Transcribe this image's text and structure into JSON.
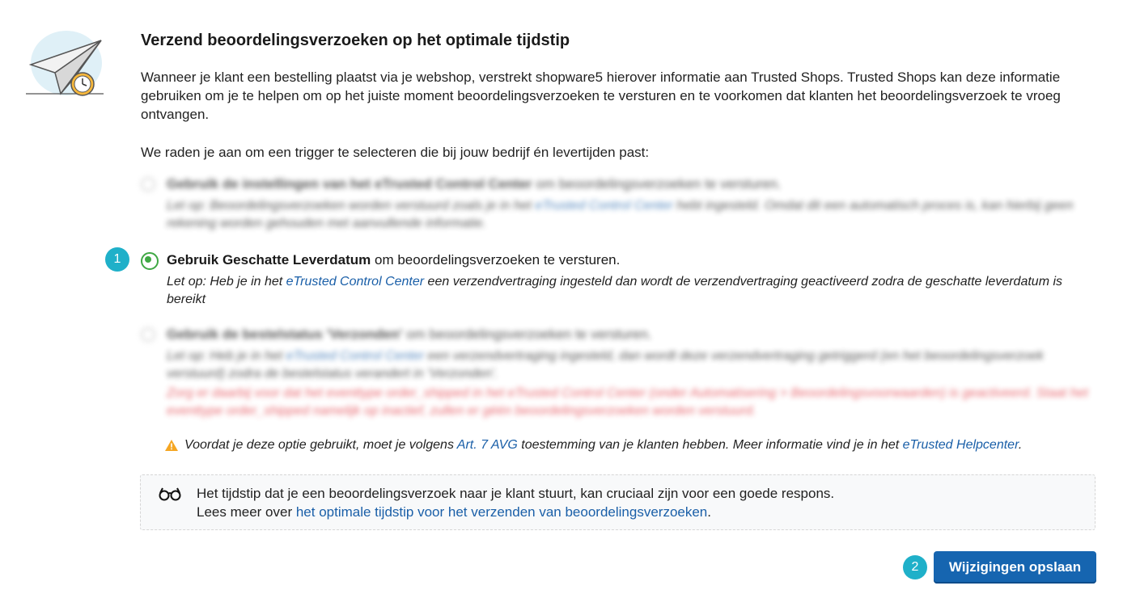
{
  "header": {
    "title": "Verzend beoordelingsverzoeken op het optimale tijdstip"
  },
  "intro": "Wanneer je klant een bestelling plaatst via je webshop, verstrekt shopware5 hierover informatie aan Trusted Shops. Trusted Shops kan deze informatie gebruiken om je te helpen om op het juiste moment beoordelingsverzoeken te versturen en te voorkomen dat klanten het beoordelingsverzoek te vroeg ontvangen.",
  "recommend": "We raden je aan om een trigger te selecteren die bij jouw bedrijf én levertijden past:",
  "options": [
    {
      "title_bold": "Gebruik de instellingen van het eTrusted Control Center",
      "title_rest": " om beoordelingsverzoeken te versturen.",
      "note_pre": "Let op: Beoordelingsverzoeken worden verstuurd zoals je in het ",
      "note_link": "eTrusted Control Center",
      "note_post": " hebt ingesteld. Omdat dit een automatisch proces is, kan hierbij geen rekening worden gehouden met aanvullende informatie.",
      "selected": false,
      "blurred": true
    },
    {
      "title_bold": "Gebruik Geschatte Leverdatum",
      "title_rest": " om beoordelingsverzoeken te versturen.",
      "note_pre": "Let op: Heb je in het ",
      "note_link": "eTrusted Control Center",
      "note_post": " een verzendvertraging ingesteld dan wordt de verzendvertraging geactiveerd zodra de geschatte leverdatum is bereikt",
      "selected": true,
      "blurred": false
    },
    {
      "title_bold": "Gebruik de bestelstatus 'Verzonden'",
      "title_rest": " om beoordelingsverzoeken te versturen.",
      "note_pre": "Let op: Heb je in het ",
      "note_link": "eTrusted Control Center",
      "note_post": " een verzendvertraging ingesteld, dan wordt deze verzendvertraging getriggerd (en het beoordelingsverzoek verstuurd) zodra de bestelstatus verandert in 'Verzonden'.",
      "note_red": "Zorg er daarbij voor dat het eventtype order_shipped in het eTrusted Control Center (onder Automatisering > Beoordelingsvoorwaarden) is geactiveerd. Staat het eventtype order_shipped namelijk op inactief, zullen er géén beoordelingsverzoeken worden verstuurd.",
      "selected": false,
      "blurred": true
    }
  ],
  "badges": {
    "step1": "1",
    "step2": "2"
  },
  "warning": {
    "pre": "Voordat je deze optie gebruikt, moet je volgens ",
    "link1": "Art. 7 AVG",
    "mid": " toestemming van je klanten hebben. Meer informatie vind je in het ",
    "link2": "eTrusted Helpcenter",
    "post": "."
  },
  "tip": {
    "line1": "Het tijdstip dat je een beoordelingsverzoek naar je klant stuurt, kan cruciaal zijn voor een goede respons.",
    "line2_pre": "Lees meer over ",
    "line2_link": "het optimale tijdstip voor het verzenden van beoordelingsverzoeken",
    "line2_post": "."
  },
  "actions": {
    "save_label": "Wijzigingen opslaan"
  },
  "colors": {
    "accent": "#1665b0",
    "link": "#1a5fa8",
    "selected_radio": "#3fa844",
    "step_badge": "#1fb0c9",
    "warning": "#f5a623",
    "error": "#e0353f"
  },
  "icons": {
    "logo": "paper-plane-clock-icon",
    "warning": "warning-triangle-icon",
    "tip": "glasses-icon"
  }
}
